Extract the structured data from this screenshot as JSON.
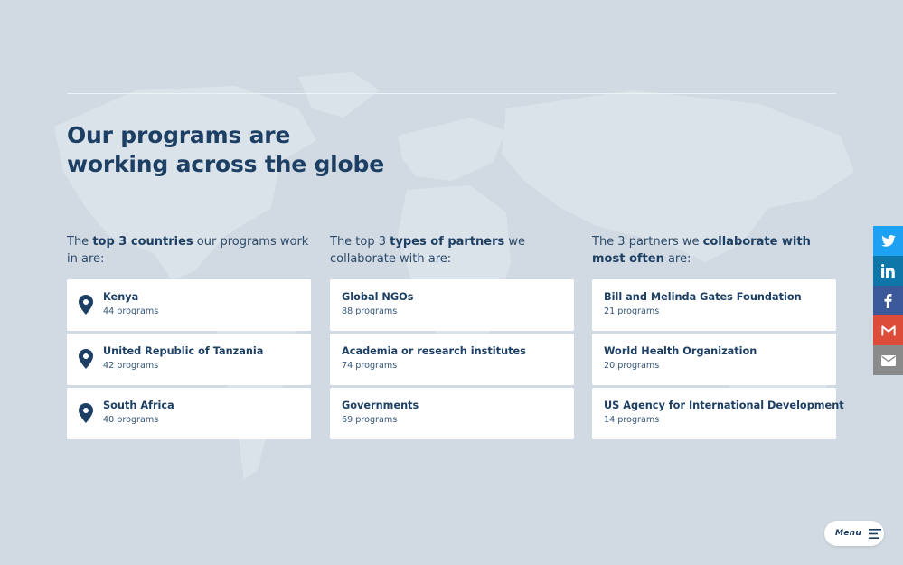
{
  "heading": {
    "line1": "Our programs are",
    "line2": "working across the globe"
  },
  "columns": [
    {
      "intro": {
        "pre": "The ",
        "bold": "top 3 countries",
        "post": " our programs work in are:"
      },
      "items": [
        {
          "name": "Kenya",
          "count": "44 programs"
        },
        {
          "name": "United Republic of Tanzania",
          "count": "42 programs"
        },
        {
          "name": "South Africa",
          "count": "40 programs"
        }
      ]
    },
    {
      "intro": {
        "pre": "The top 3 ",
        "bold": "types of partners",
        "post": " we collaborate with are:"
      },
      "items": [
        {
          "name": "Global NGOs",
          "count": "88 programs"
        },
        {
          "name": "Academia or research institutes",
          "count": "74 programs"
        },
        {
          "name": "Governments",
          "count": "69 programs"
        }
      ]
    },
    {
      "intro": {
        "pre": "The 3 partners we ",
        "bold": "collaborate with most often",
        "post": " are:"
      },
      "items": [
        {
          "name": "Bill and Melinda Gates Foundation",
          "count": "21 programs"
        },
        {
          "name": "World Health Organization",
          "count": "20 programs"
        },
        {
          "name": "US Agency for International Development",
          "count": "14 programs"
        }
      ]
    }
  ],
  "share": [
    {
      "icon": "twitter-icon",
      "color": "#1da1f2"
    },
    {
      "icon": "linkedin-icon",
      "color": "#0e76a8"
    },
    {
      "icon": "facebook-icon",
      "color": "#3b5998"
    },
    {
      "icon": "gmail-icon",
      "color": "#dd4b39"
    },
    {
      "icon": "email-icon",
      "color": "#8a8a8a"
    }
  ],
  "menu": {
    "label": "Menu"
  },
  "colors": {
    "background": "#d1dae2",
    "navy": "#1d3f63",
    "card": "#ffffff"
  }
}
